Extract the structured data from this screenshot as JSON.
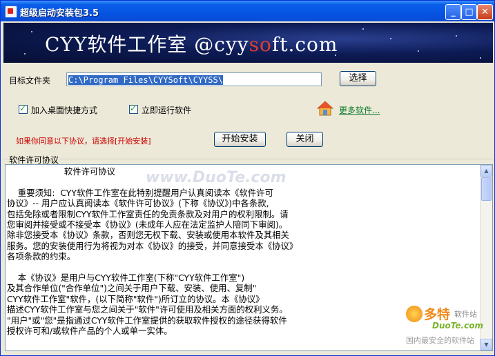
{
  "window": {
    "title": "超级启动安装包3.5",
    "controls": {
      "minimize": "_",
      "maximize": "□",
      "close": "✕"
    }
  },
  "banner": {
    "prefix": "CYY软件工作室 @cyy",
    "highlight": "so",
    "suffix": "ft.com"
  },
  "target": {
    "label": "目标文件夹",
    "path": "C:\\Program Files\\CYYSoft\\CYYSS\\",
    "browse_label": "选择"
  },
  "options": {
    "desktop_shortcut": {
      "label": "加入桌面快捷方式",
      "checked": true
    },
    "run_now": {
      "label": "立即运行软件",
      "checked": true
    },
    "more_link": "更多软件..."
  },
  "actions": {
    "notice": "如果你同意以下协议，请选择[开始安装]",
    "install_label": "开始安装",
    "close_label": "关闭"
  },
  "license": {
    "group_label": "软件许可协议",
    "text": "                     软件许可协议\n\n    重要须知:  CYY软件工作室在此特别提醒用户认真阅读本《软件许可\n协议》-- 用户应认真阅读本《软件许可协议》(下称《协议》)中各条款,\n包括免除或者限制CYY软件工作室责任的免责条款及对用户的权利限制。请\n您审阅并接受或不接受本《协议》(未成年人应在法定监护人陪同下审阅)。\n除非您接受本《协议》条款，否则您无权下载、安装或使用本软件及其相关\n服务。您的安装使用行为将视为对本《协议》的接受，并同意接受本《协议》\n各项条款的约束。\n\n    本《协议》是用户与CYY软件工作室(下称\"CYY软件工作室\")\n及其合作单位(\"合作单位\")之间关于用户下载、安装、使用、复制\"\nCYY软件工作室\"软件，(以下简称\"软件\")所订立的协议。本《协议》\n描述CYY软件工作室与您之间关于\"软件\"许可使用及相关方面的权利义务。\n\"用户\"或\"您\"是指通过CYY软件工作室提供的获取软件授权的途径获得软件\n授权许可和/或软件产品的个人或单一实体。"
  },
  "watermarks": {
    "center": "www.DuoTe.com",
    "corner_title": "多特",
    "corner_sub": "软件站",
    "corner_url": "DuoTe.com",
    "corner_slogan": "国内最安全的软件站"
  },
  "colors": {
    "titlebar": "#0554e3",
    "banner_bg": "#0d1b55",
    "notice": "#cc0000",
    "link": "#08792a"
  }
}
